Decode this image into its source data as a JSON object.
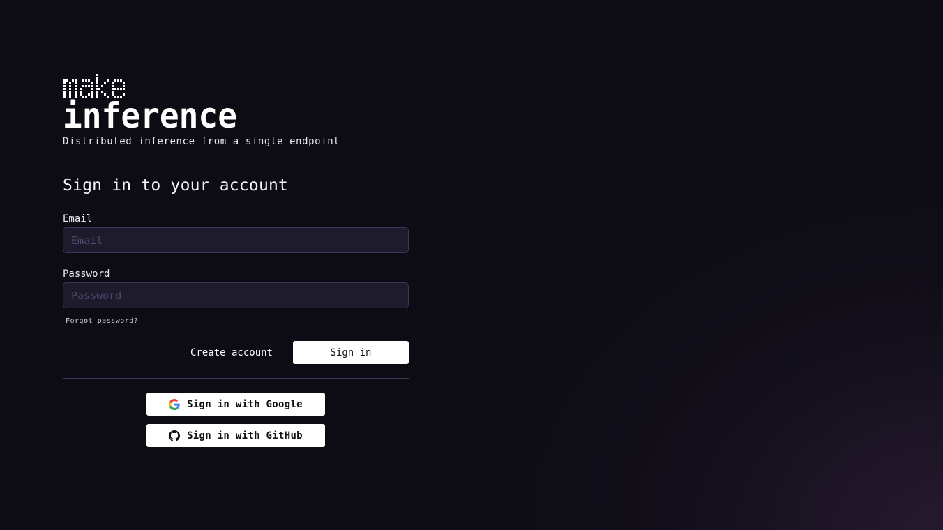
{
  "brand": {
    "line1": "make",
    "line2": "inference",
    "tagline": "Distributed inference from a single endpoint"
  },
  "form": {
    "heading": "Sign in to your account",
    "email": {
      "label": "Email",
      "placeholder": "Email",
      "value": ""
    },
    "password": {
      "label": "Password",
      "placeholder": "Password",
      "value": ""
    },
    "forgot_label": "Forgot password?",
    "create_label": "Create account",
    "signin_label": "Sign in"
  },
  "oauth": {
    "google_label": "Sign in with Google",
    "github_label": "Sign in with GitHub",
    "google_icon": "google-icon",
    "github_icon": "github-icon"
  },
  "colors": {
    "background": "#0d0c14",
    "input_bg": "#1d1b2c",
    "input_border": "#3a3655",
    "divider": "#3d3858",
    "button_bg": "#ffffff"
  }
}
